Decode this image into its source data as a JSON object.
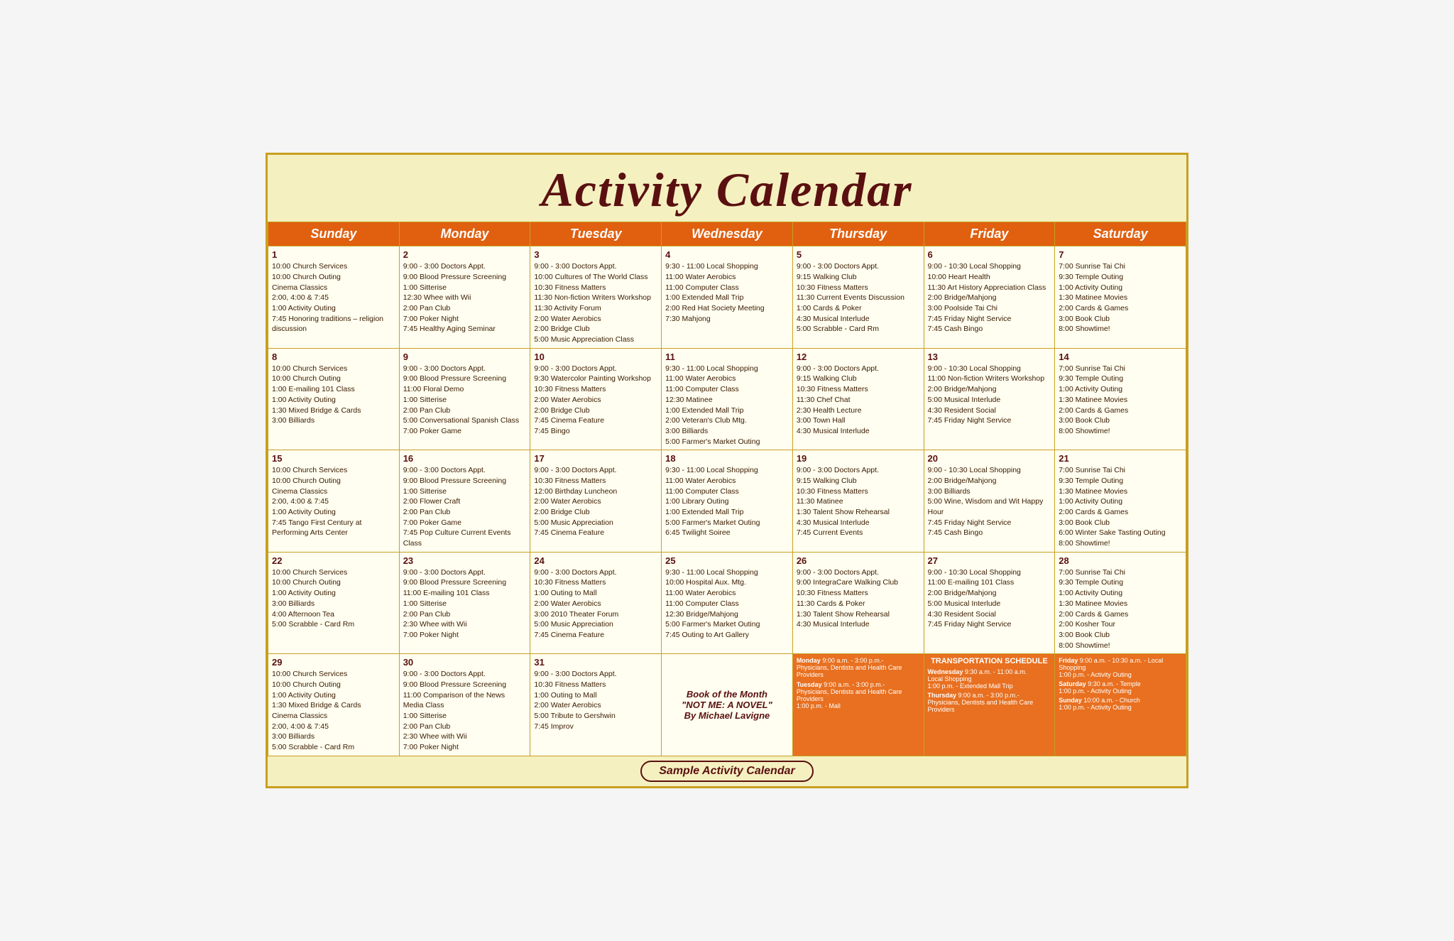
{
  "title": "Activity Calendar",
  "footer": "Sample Activity Calendar",
  "days": [
    "Sunday",
    "Monday",
    "Tuesday",
    "Wednesday",
    "Thursday",
    "Friday",
    "Saturday"
  ],
  "weeks": [
    [
      {
        "date": "1",
        "events": [
          "10:00 Church Services",
          "10:00 Church Outing",
          "Cinema Classics",
          "2:00, 4:00 & 7:45",
          "1:00 Activity Outing",
          "7:45 Honoring traditions – religion discussion"
        ]
      },
      {
        "date": "2",
        "events": [
          "9:00 - 3:00 Doctors Appt.",
          "9:00 Blood Pressure Screening",
          "1:00 Sitterise",
          "12:30 Whee with Wii",
          "2:00 Pan Club",
          "7:00 Poker Night",
          "7:45 Healthy Aging Seminar"
        ]
      },
      {
        "date": "3",
        "events": [
          "9:00 - 3:00 Doctors Appt.",
          "10:00 Cultures of The World Class",
          "10:30 Fitness Matters",
          "11:30 Non-fiction Writers Workshop",
          "11:30 Activity Forum",
          "2:00 Water Aerobics",
          "2:00 Bridge Club",
          "5:00 Music Appreciation Class"
        ]
      },
      {
        "date": "4",
        "events": [
          "9:30 - 11:00 Local Shopping",
          "11:00 Water Aerobics",
          "11:00 Computer Class",
          "1:00 Extended Mall Trip",
          "2:00 Red Hat Society Meeting",
          "7:30 Mahjong"
        ]
      },
      {
        "date": "5",
        "events": [
          "9:00 - 3:00 Doctors Appt.",
          "9:15 Walking Club",
          "10:30 Fitness Matters",
          "11:30 Current Events Discussion",
          "1:00 Cards & Poker",
          "4:30 Musical Interlude",
          "5:00 Scrabble - Card Rm"
        ]
      },
      {
        "date": "6",
        "events": [
          "9:00 - 10:30 Local Shopping",
          "10:00 Heart Health",
          "11:30 Art History Appreciation Class",
          "2:00 Bridge/Mahjong",
          "3:00 Poolside Tai Chi",
          "7:45 Friday Night Service",
          "7:45 Cash Bingo"
        ]
      },
      {
        "date": "7",
        "events": [
          "7:00 Sunrise Tai Chi",
          "9:30 Temple Outing",
          "1:00 Activity Outing",
          "1:30 Matinee Movies",
          "2:00 Cards & Games",
          "3:00 Book Club",
          "8:00 Showtime!"
        ]
      }
    ],
    [
      {
        "date": "8",
        "events": [
          "10:00 Church Services",
          "10:00 Church Outing",
          "1:00 E-mailing 101 Class",
          "1:00 Activity Outing",
          "1:30 Mixed Bridge & Cards",
          "3:00 Billiards"
        ]
      },
      {
        "date": "9",
        "events": [
          "9:00 - 3:00 Doctors Appt.",
          "9:00 Blood Pressure Screening",
          "11:00 Floral Demo",
          "1:00 Sitterise",
          "2:00 Pan Club",
          "5:00 Conversational Spanish Class",
          "7:00 Poker Game"
        ]
      },
      {
        "date": "10",
        "events": [
          "9:00 - 3:00 Doctors Appt.",
          "9:30 Watercolor Painting Workshop",
          "10:30 Fitness Matters",
          "2:00 Water Aerobics",
          "2:00 Bridge Club",
          "7:45 Cinema Feature",
          "7:45 Bingo"
        ]
      },
      {
        "date": "11",
        "events": [
          "9:30 - 11:00 Local Shopping",
          "11:00 Water Aerobics",
          "11:00 Computer Class",
          "12:30 Matinee",
          "1:00 Extended Mall Trip",
          "2:00 Veteran's Club Mtg.",
          "3:00 Billiards",
          "5:00 Farmer's Market Outing"
        ]
      },
      {
        "date": "12",
        "events": [
          "9:00 - 3:00 Doctors Appt.",
          "9:15 Walking Club",
          "10:30 Fitness Matters",
          "11:30 Chef Chat",
          "2:30 Health Lecture",
          "3:00 Town Hall",
          "4:30 Musical Interlude"
        ]
      },
      {
        "date": "13",
        "events": [
          "9:00 - 10:30 Local Shopping",
          "11:00 Non-fiction Writers Workshop",
          "2:00 Bridge/Mahjong",
          "5:00 Musical Interlude",
          "4:30 Resident Social",
          "7:45 Friday Night Service"
        ]
      },
      {
        "date": "14",
        "events": [
          "7:00 Sunrise Tai Chi",
          "9:30 Temple Outing",
          "1:00 Activity Outing",
          "1:30 Matinee Movies",
          "2:00 Cards & Games",
          "3:00 Book Club",
          "8:00 Showtime!"
        ]
      }
    ],
    [
      {
        "date": "15",
        "events": [
          "10:00 Church Services",
          "10:00 Church Outing",
          "Cinema Classics",
          "2:00, 4:00 & 7:45",
          "1:00 Activity Outing",
          "7:45 Tango First Century at Performing Arts Center"
        ]
      },
      {
        "date": "16",
        "events": [
          "9:00 - 3:00 Doctors Appt.",
          "9:00 Blood Pressure Screening",
          "1:00 Sitterise",
          "2:00 Flower Craft",
          "2:00 Pan Club",
          "7:00 Poker Game",
          "7:45 Pop Culture Current Events Class"
        ]
      },
      {
        "date": "17",
        "events": [
          "9:00 - 3:00 Doctors Appt.",
          "10:30 Fitness Matters",
          "12:00 Birthday Luncheon",
          "2:00 Water Aerobics",
          "2:00 Bridge Club",
          "5:00 Music Appreciation",
          "7:45 Cinema Feature"
        ]
      },
      {
        "date": "18",
        "events": [
          "9:30 - 11:00 Local Shopping",
          "11:00 Water Aerobics",
          "11:00 Computer Class",
          "1:00 Library Outing",
          "1:00 Extended Mall Trip",
          "5:00 Farmer's Market Outing",
          "6:45 Twilight Soiree"
        ]
      },
      {
        "date": "19",
        "events": [
          "9:00 - 3:00 Doctors Appt.",
          "9:15 Walking Club",
          "10:30 Fitness Matters",
          "11:30 Matinee",
          "1:30 Talent Show Rehearsal",
          "4:30 Musical Interlude",
          "7:45 Current Events"
        ]
      },
      {
        "date": "20",
        "events": [
          "9:00 - 10:30 Local Shopping",
          "2:00 Bridge/Mahjong",
          "3:00 Billiards",
          "5:00 Wine, Wisdom and Wit Happy Hour",
          "7:45 Friday Night Service",
          "7:45 Cash Bingo"
        ]
      },
      {
        "date": "21",
        "events": [
          "7:00 Sunrise Tai Chi",
          "9:30 Temple Outing",
          "1:30 Matinee Movies",
          "1:00 Activity Outing",
          "2:00 Cards & Games",
          "3:00 Book Club",
          "6:00 Winter Sake Tasting Outing",
          "8:00 Showtime!"
        ]
      }
    ],
    [
      {
        "date": "22",
        "events": [
          "10:00 Church Services",
          "10:00 Church Outing",
          "1:00 Activity Outing",
          "3:00 Billiards",
          "4:00 Afternoon Tea",
          "5:00 Scrabble - Card Rm"
        ]
      },
      {
        "date": "23",
        "events": [
          "9:00 - 3:00 Doctors Appt.",
          "9:00 Blood Pressure Screening",
          "11:00 E-mailing 101 Class",
          "1:00 Sitterise",
          "2:00 Pan Club",
          "2:30 Whee with Wii",
          "7:00 Poker Night"
        ]
      },
      {
        "date": "24",
        "events": [
          "9:00 - 3:00 Doctors Appt.",
          "10:30 Fitness Matters",
          "1:00 Outing to Mall",
          "2:00 Water Aerobics",
          "3:00 2010 Theater Forum",
          "5:00 Music Appreciation",
          "7:45 Cinema Feature"
        ]
      },
      {
        "date": "25",
        "events": [
          "9:30 - 11:00 Local Shopping",
          "10:00 Hospital Aux. Mtg.",
          "11:00 Water Aerobics",
          "11:00 Computer Class",
          "12:30 Bridge/Mahjong",
          "5:00 Farmer's Market Outing",
          "7:45 Outing to Art Gallery"
        ]
      },
      {
        "date": "26",
        "events": [
          "9:00 - 3:00 Doctors Appt.",
          "9:00 IntegraCare Walking Club",
          "10:30 Fitness Matters",
          "11:30 Cards & Poker",
          "1:30 Talent Show Rehearsal",
          "4:30 Musical Interlude"
        ]
      },
      {
        "date": "27",
        "events": [
          "9:00 - 10:30 Local Shopping",
          "11:00 E-mailing 101 Class",
          "2:00 Bridge/Mahjong",
          "5:00 Musical Interlude",
          "4:30 Resident Social",
          "7:45 Friday Night Service"
        ]
      },
      {
        "date": "28",
        "events": [
          "7:00 Sunrise Tai Chi",
          "9:30 Temple Outing",
          "1:00 Activity Outing",
          "1:30 Matinee Movies",
          "2:00 Cards & Games",
          "2:00 Kosher Tour",
          "3:00 Book Club",
          "8:00 Showtime!"
        ]
      }
    ],
    [
      {
        "date": "29",
        "events": [
          "10:00 Church Services",
          "10:00 Church Outing",
          "1:00 Activity Outing",
          "1:30 Mixed Bridge & Cards",
          "Cinema Classics",
          "2:00, 4:00 & 7:45",
          "3:00 Billiards",
          "5:00 Scrabble - Card Rm"
        ]
      },
      {
        "date": "30",
        "events": [
          "9:00 - 3:00 Doctors Appt.",
          "9:00 Blood Pressure Screening",
          "11:00 Comparison of the News Media Class",
          "1:00 Sitterise",
          "2:00 Pan Club",
          "2:30 Whee with Wii",
          "7:00 Poker Night"
        ]
      },
      {
        "date": "31",
        "events": [
          "9:00 - 3:00 Doctors Appt.",
          "10:30 Fitness Matters",
          "1:00 Outing to Mall",
          "2:00 Water Aerobics",
          "5:00 Tribute to Gershwin",
          "7:45 Improv"
        ]
      }
    ]
  ],
  "book_of_month": {
    "label": "Book of the Month",
    "title": "\"NOT ME: A NOVEL\"",
    "author": "By Michael Lavigne"
  },
  "transport": {
    "header": "TRANSPORTATION SCHEDULE",
    "monday": "Monday 9:00 a.m. - 3:00 p.m.- Physicians, Dentists and Health Care Providers",
    "tuesday": "Tuesday 9:00 a.m. - 3:00 p.m.- Physicians, Dentists and Health Care Providers\n1:00 p.m. - Mall",
    "wednesday": "Wednesday 9:30 a.m. - 11:00 a.m. Local Shopping\n1:00 p.m. - Extended Mall Trip\nThursday 9:00 a.m. - 3:00 p.m.- Physicians, Dentists and Health Care Providers",
    "friday": "Friday 9:00 a.m. - 10:30 a.m. - Local Shopping\n1:00 p.m. - Activity Outing\nSaturday 9:30 a.m. - Temple\n1:00 p.m. - Activity Outing\nSunday 10:00 a.m. - Church\n1:00 p.m. - Activity Outing"
  }
}
